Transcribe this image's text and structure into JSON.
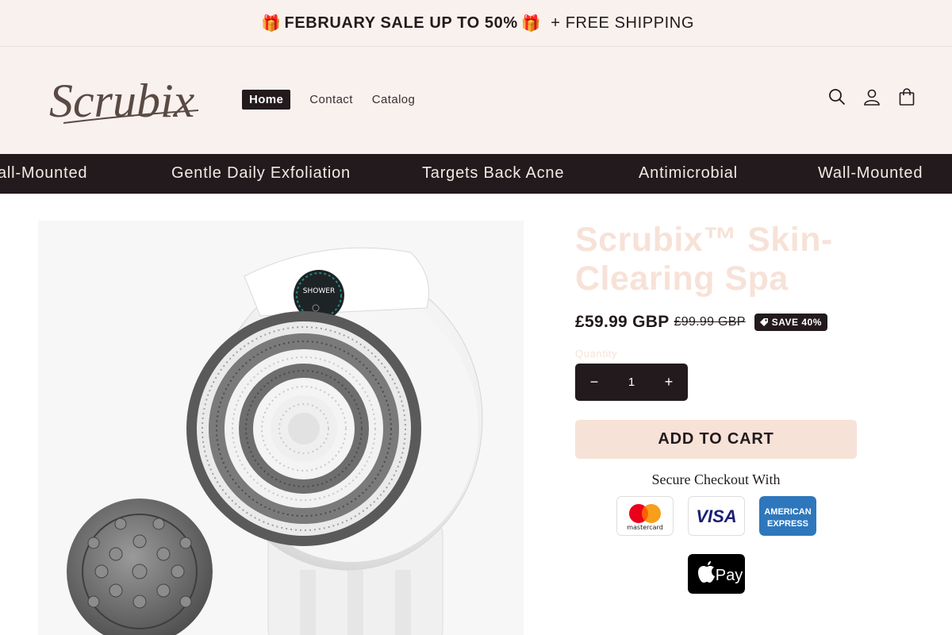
{
  "announcement": {
    "gift_icon": "🎁",
    "sale_text": "FEBRUARY SALE UP TO 50%",
    "extra_text": "+ FREE SHIPPING"
  },
  "header": {
    "logo_text": "Scrubix",
    "nav": [
      {
        "label": "Home",
        "active": true
      },
      {
        "label": "Contact",
        "active": false
      },
      {
        "label": "Catalog",
        "active": false
      }
    ],
    "icons": [
      "search-icon",
      "account-icon",
      "cart-icon"
    ]
  },
  "marquee": {
    "items": [
      "Wall-Mounted",
      "Gentle Daily Exfoliation",
      "Targets Back Acne",
      "Antimicrobial",
      "Wall-Mounted"
    ],
    "leading_fragment": "all-Mounted"
  },
  "product": {
    "device_label": "SHOWER",
    "title": "Scrubix™ Skin-Clearing Spa",
    "price": "£59.99 GBP",
    "compare_price": "£99.99 GBP",
    "badge": "SAVE 40%",
    "quantity_label": "Quantity",
    "quantity_value": "1",
    "decrease_symbol": "−",
    "increase_symbol": "+",
    "add_to_cart": "ADD TO CART",
    "secure_checkout": "Secure Checkout With",
    "payment_methods": [
      {
        "name": "mastercard",
        "label": "mastercard"
      },
      {
        "name": "visa",
        "label": "VISA"
      },
      {
        "name": "amex",
        "label": "AMERICAN EXPRESS",
        "label_line1": "AMERICAN",
        "label_line2": "EXPRESS"
      },
      {
        "name": "apple-pay",
        "label": "Pay"
      }
    ]
  },
  "colors": {
    "dark": "#231a1d",
    "cream": "#f9f1ee",
    "peach": "#f7e2d8"
  }
}
